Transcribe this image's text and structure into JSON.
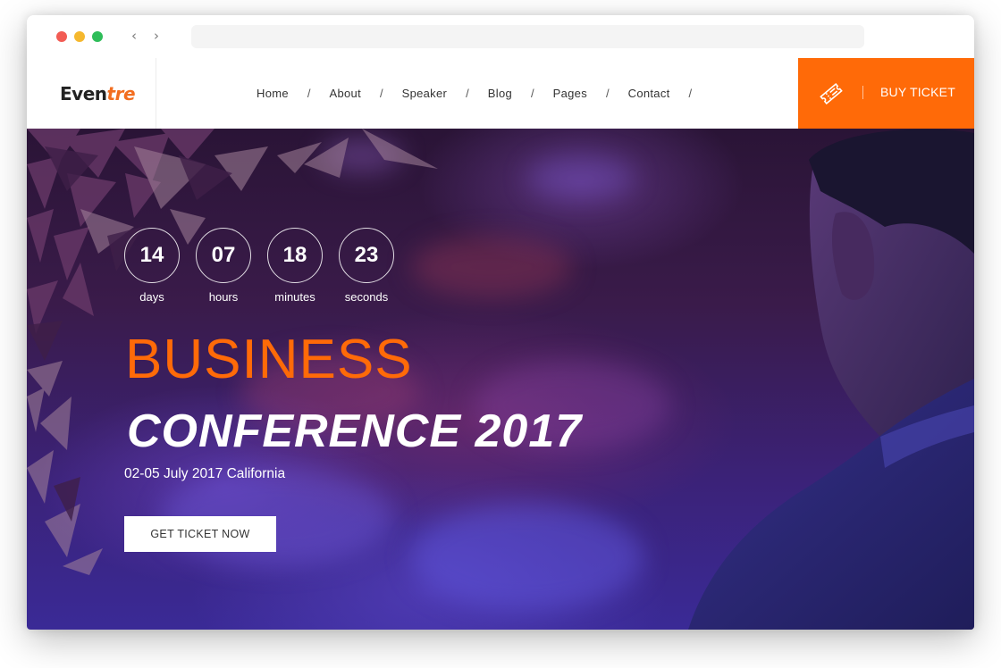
{
  "browser": {
    "back_icon": "chevron-left-icon",
    "forward_icon": "chevron-right-icon"
  },
  "header": {
    "logo_part1": "Even",
    "logo_part2": "tre",
    "nav": [
      {
        "label": "Home"
      },
      {
        "label": "About"
      },
      {
        "label": "Speaker"
      },
      {
        "label": "Blog"
      },
      {
        "label": "Pages"
      },
      {
        "label": "Contact"
      }
    ],
    "separator": "/",
    "buy_ticket": {
      "label": "BUY TICKET",
      "icon": "ticket-icon",
      "background": "#ff6a08"
    }
  },
  "hero": {
    "countdown": [
      {
        "value": "14",
        "label": "days"
      },
      {
        "value": "07",
        "label": "hours"
      },
      {
        "value": "18",
        "label": "minutes"
      },
      {
        "value": "23",
        "label": "seconds"
      }
    ],
    "title_line1": "BUSINESS",
    "title_line2": "CONFERENCE 2017",
    "date_location": "02-05 July 2017 California",
    "cta_label": "GET TICKET NOW",
    "accent_color": "#ff6a08"
  }
}
